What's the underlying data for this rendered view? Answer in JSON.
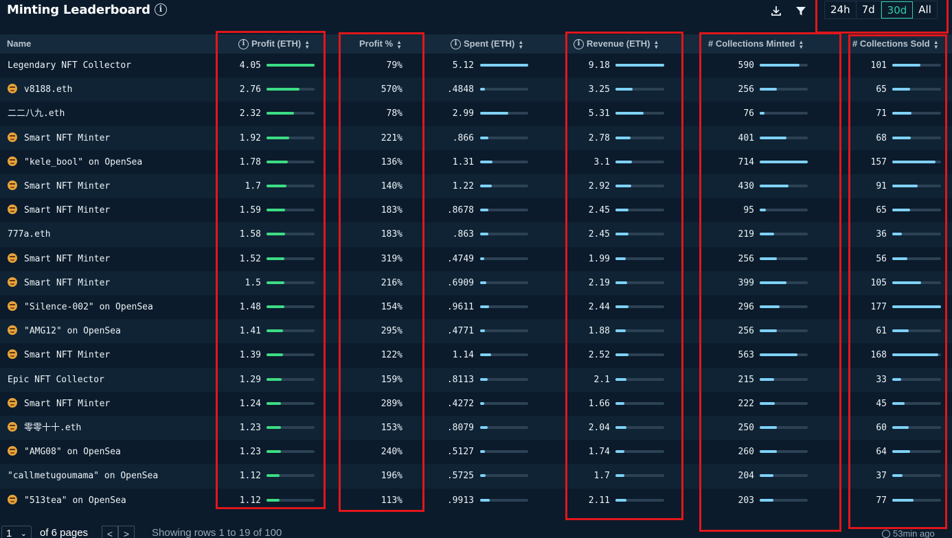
{
  "header": {
    "title": "Minting Leaderboard",
    "info_glyph": "i",
    "download_icon": "download-icon",
    "filter_icon": "filter-icon",
    "ranges": [
      {
        "label": "24h",
        "active": false
      },
      {
        "label": "7d",
        "active": false
      },
      {
        "label": "30d",
        "active": true
      },
      {
        "label": "All",
        "active": false
      }
    ]
  },
  "columns": {
    "name": "Name",
    "profit": "Profit (ETH)",
    "profit_pct": "Profit %",
    "spent": "Spent (ETH)",
    "revenue": "Revenue (ETH)",
    "minted": "# Collections Minted",
    "sold": "# Collections Sold"
  },
  "colors": {
    "background": "#0b1b2b",
    "profit_bar": "#3ddc84",
    "other_bar": "#7fd1f7",
    "bar_track": "#2c4254",
    "active_range": "#2fd0a6",
    "highlight": "#e1161b"
  },
  "rows": [
    {
      "name": "Legendary NFT Collector",
      "avatar": false,
      "profit": "4.05",
      "profit_pct": "79%",
      "spent": "5.12",
      "revenue": "9.18",
      "minted": "590",
      "sold": "101"
    },
    {
      "name": "v8188.eth",
      "avatar": true,
      "profit": "2.76",
      "profit_pct": "570%",
      "spent": ".4848",
      "revenue": "3.25",
      "minted": "256",
      "sold": "65"
    },
    {
      "name": "二二八九.eth",
      "avatar": false,
      "profit": "2.32",
      "profit_pct": "78%",
      "spent": "2.99",
      "revenue": "5.31",
      "minted": "76",
      "sold": "71"
    },
    {
      "name": "Smart NFT Minter",
      "avatar": true,
      "profit": "1.92",
      "profit_pct": "221%",
      "spent": ".866",
      "revenue": "2.78",
      "minted": "401",
      "sold": "68"
    },
    {
      "name": "\"kele_bool\" on OpenSea",
      "avatar": true,
      "profit": "1.78",
      "profit_pct": "136%",
      "spent": "1.31",
      "revenue": "3.1",
      "minted": "714",
      "sold": "157"
    },
    {
      "name": "Smart NFT Minter",
      "avatar": true,
      "profit": "1.7",
      "profit_pct": "140%",
      "spent": "1.22",
      "revenue": "2.92",
      "minted": "430",
      "sold": "91"
    },
    {
      "name": "Smart NFT Minter",
      "avatar": true,
      "profit": "1.59",
      "profit_pct": "183%",
      "spent": ".8678",
      "revenue": "2.45",
      "minted": "95",
      "sold": "65"
    },
    {
      "name": "777a.eth",
      "avatar": false,
      "profit": "1.58",
      "profit_pct": "183%",
      "spent": ".863",
      "revenue": "2.45",
      "minted": "219",
      "sold": "36"
    },
    {
      "name": "Smart NFT Minter",
      "avatar": true,
      "profit": "1.52",
      "profit_pct": "319%",
      "spent": ".4749",
      "revenue": "1.99",
      "minted": "256",
      "sold": "56"
    },
    {
      "name": "Smart NFT Minter",
      "avatar": true,
      "profit": "1.5",
      "profit_pct": "216%",
      "spent": ".6909",
      "revenue": "2.19",
      "minted": "399",
      "sold": "105"
    },
    {
      "name": "\"Silence-002\" on OpenSea",
      "avatar": true,
      "profit": "1.48",
      "profit_pct": "154%",
      "spent": ".9611",
      "revenue": "2.44",
      "minted": "296",
      "sold": "177"
    },
    {
      "name": "\"AMG12\" on OpenSea",
      "avatar": true,
      "profit": "1.41",
      "profit_pct": "295%",
      "spent": ".4771",
      "revenue": "1.88",
      "minted": "256",
      "sold": "61"
    },
    {
      "name": "Smart NFT Minter",
      "avatar": true,
      "profit": "1.39",
      "profit_pct": "122%",
      "spent": "1.14",
      "revenue": "2.52",
      "minted": "563",
      "sold": "168"
    },
    {
      "name": "Epic NFT Collector",
      "avatar": false,
      "profit": "1.29",
      "profit_pct": "159%",
      "spent": ".8113",
      "revenue": "2.1",
      "minted": "215",
      "sold": "33"
    },
    {
      "name": "Smart NFT Minter",
      "avatar": true,
      "profit": "1.24",
      "profit_pct": "289%",
      "spent": ".4272",
      "revenue": "1.66",
      "minted": "222",
      "sold": "45"
    },
    {
      "name": "零零十十.eth",
      "avatar": true,
      "profit": "1.23",
      "profit_pct": "153%",
      "spent": ".8079",
      "revenue": "2.04",
      "minted": "250",
      "sold": "60"
    },
    {
      "name": "\"AMG08\" on OpenSea",
      "avatar": true,
      "profit": "1.23",
      "profit_pct": "240%",
      "spent": ".5127",
      "revenue": "1.74",
      "minted": "260",
      "sold": "64"
    },
    {
      "name": "\"callmetugoumama\" on OpenSea",
      "avatar": false,
      "profit": "1.12",
      "profit_pct": "196%",
      "spent": ".5725",
      "revenue": "1.7",
      "minted": "204",
      "sold": "37"
    },
    {
      "name": "\"513tea\" on OpenSea",
      "avatar": true,
      "profit": "1.12",
      "profit_pct": "113%",
      "spent": ".9913",
      "revenue": "2.11",
      "minted": "203",
      "sold": "77"
    }
  ],
  "footer": {
    "page_value": "1",
    "of_pages": "of 6 pages",
    "prev_glyph": "<",
    "next_glyph": ">",
    "showing": "Showing rows 1 to 19 of 100",
    "updated": "53min ago"
  }
}
